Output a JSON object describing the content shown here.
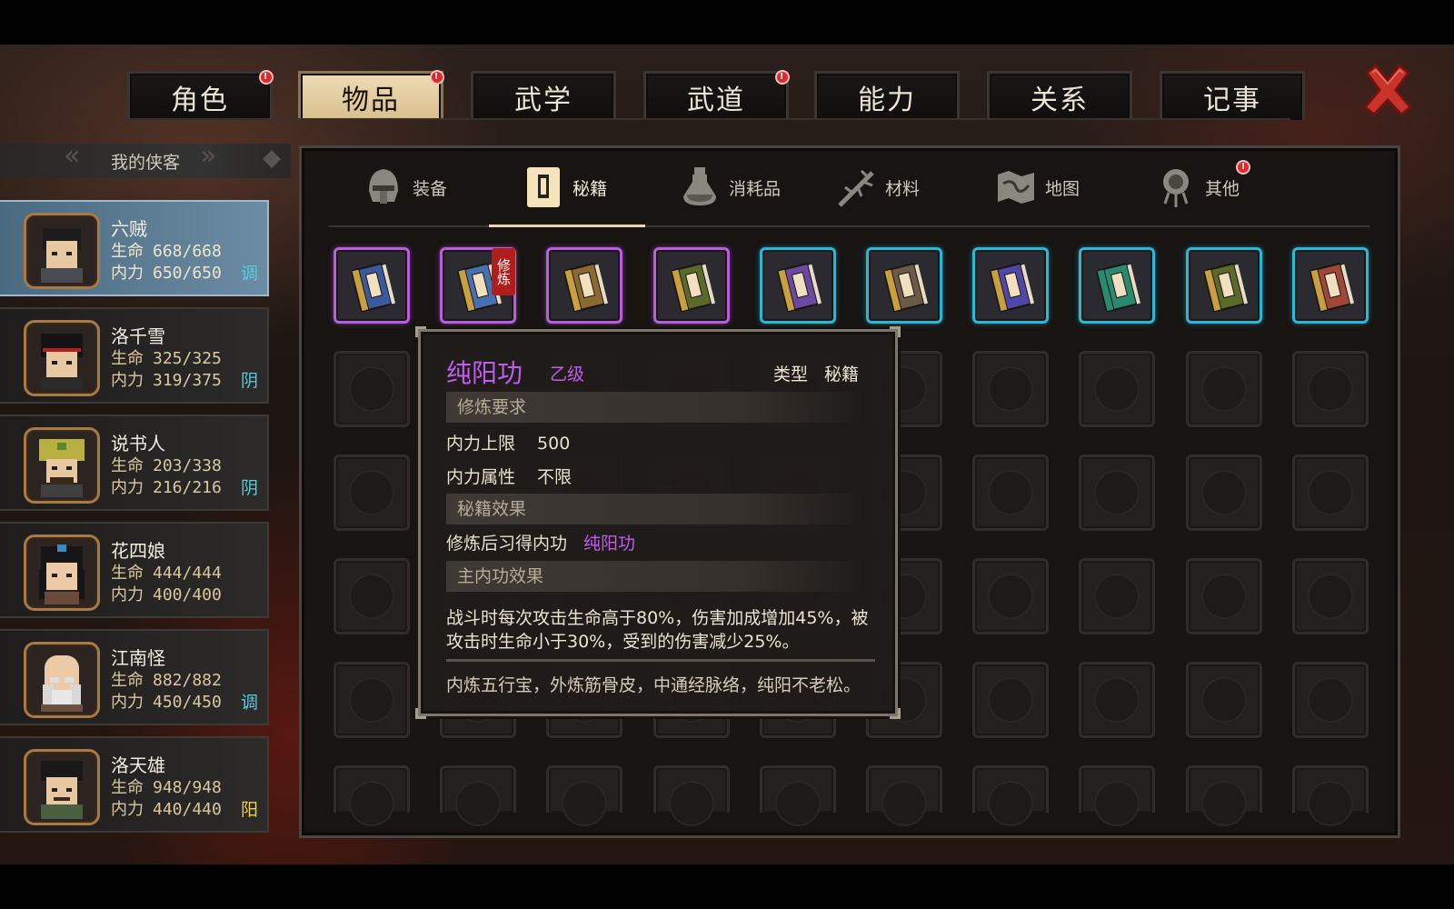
{
  "top_tabs": [
    {
      "label": "角色",
      "badge": "!"
    },
    {
      "label": "物品",
      "badge": "!",
      "active": true
    },
    {
      "label": "武学"
    },
    {
      "label": "武道",
      "badge": "!"
    },
    {
      "label": "能力"
    },
    {
      "label": "关系"
    },
    {
      "label": "记事"
    }
  ],
  "sidebar": {
    "title": "我的侠客",
    "characters": [
      {
        "name": "六贼",
        "hp_label": "生命",
        "hp": "668/668",
        "mp_label": "内力",
        "mp": "650/650",
        "alignment": "调",
        "alignment_color": "#4fd0e0",
        "active": true
      },
      {
        "name": "洛千雪",
        "hp_label": "生命",
        "hp": "325/325",
        "mp_label": "内力",
        "mp": "319/375",
        "alignment": "阴",
        "alignment_color": "#4fd0e0"
      },
      {
        "name": "说书人",
        "hp_label": "生命",
        "hp": "203/338",
        "mp_label": "内力",
        "mp": "216/216",
        "alignment": "阴",
        "alignment_color": "#4fd0e0"
      },
      {
        "name": "花四娘",
        "hp_label": "生命",
        "hp": "444/444",
        "mp_label": "内力",
        "mp": "400/400",
        "alignment": "",
        "alignment_color": "#4fd0e0"
      },
      {
        "name": "江南怪",
        "hp_label": "生命",
        "hp": "882/882",
        "mp_label": "内力",
        "mp": "450/450",
        "alignment": "调",
        "alignment_color": "#4fd0e0"
      },
      {
        "name": "洛天雄",
        "hp_label": "生命",
        "hp": "948/948",
        "mp_label": "内力",
        "mp": "440/440",
        "alignment": "阳",
        "alignment_color": "#f0d040"
      }
    ]
  },
  "categories": [
    {
      "label": "装备",
      "icon": "helmet-icon"
    },
    {
      "label": "秘籍",
      "icon": "book-icon",
      "active": true
    },
    {
      "label": "消耗品",
      "icon": "potion-icon"
    },
    {
      "label": "材料",
      "icon": "herb-icon"
    },
    {
      "label": "地图",
      "icon": "map-icon"
    },
    {
      "label": "其他",
      "icon": "pendant-icon",
      "badge": "!"
    }
  ],
  "items": [
    {
      "rarity": "purple",
      "color": "#3a5aa0",
      "spine": "#c8a040"
    },
    {
      "rarity": "purple",
      "color": "#4870b0",
      "spine": "#c8a040",
      "tag": "修炼"
    },
    {
      "rarity": "purple",
      "color": "#8a6a30",
      "spine": "#c8a040"
    },
    {
      "rarity": "purple",
      "color": "#5a6a28",
      "spine": "#c8a040"
    },
    {
      "rarity": "cyan",
      "color": "#6a4aa0",
      "spine": "#c8a040"
    },
    {
      "rarity": "cyan",
      "color": "#6a5a48",
      "spine": "#c8a040"
    },
    {
      "rarity": "cyan",
      "color": "#5048a8",
      "spine": "#c8a040"
    },
    {
      "rarity": "cyan",
      "color": "#2a8a70",
      "spine": "#2a8a70"
    },
    {
      "rarity": "cyan",
      "color": "#5a6a28",
      "spine": "#c8a040"
    },
    {
      "rarity": "cyan",
      "color": "#a04838",
      "spine": "#c8a040"
    }
  ],
  "tooltip": {
    "title": "纯阳功",
    "grade": "乙级",
    "type_label": "类型",
    "type_value": "秘籍",
    "section_requirements": "修炼要求",
    "req_mp_label": "内力上限",
    "req_mp_value": "500",
    "req_attr_label": "内力属性",
    "req_attr_value": "不限",
    "section_effect": "秘籍效果",
    "effect_label": "修炼后习得内功",
    "effect_value": "纯阳功",
    "section_main": "主内功效果",
    "main_desc": "战斗时每次攻击生命高于80%，伤害加成增加45%，被攻击时生命小于30%，受到的伤害减少25%。",
    "flavor": "内炼五行宝，外炼筋骨皮，中通经脉络，纯阳不老松。"
  }
}
